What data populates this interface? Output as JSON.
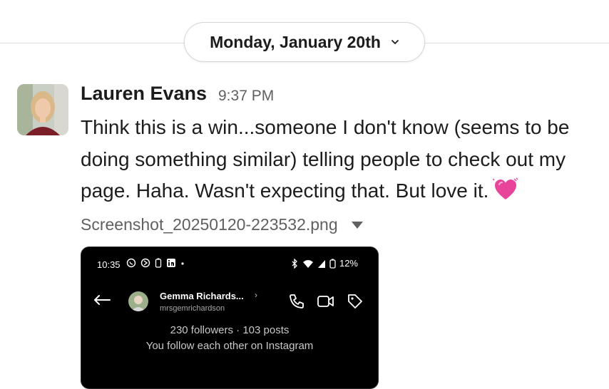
{
  "date_divider": {
    "label": "Monday, January 20th",
    "icon": "chevron-down-icon"
  },
  "message": {
    "author": "Lauren Evans",
    "time": "9:37 PM",
    "text": "Think this is a win...someone I don't know (seems to be doing something similar) telling people to check out my page. Haha. Wasn't expecting that. But love it.",
    "emoji": "heart-pulse-icon"
  },
  "attachment": {
    "file_name": "Screenshot_20250120-223532.png",
    "menu_icon": "caret-down-icon"
  },
  "screenshot": {
    "status_time": "10:35",
    "battery": "12%",
    "profile_name": "Gemma Richards...",
    "profile_handle": "mrsgemrichardson",
    "stats": "230 followers · 103 posts",
    "mutual": "You follow each other on Instagram"
  },
  "colors": {
    "text": "#1d1c1d",
    "muted": "#616061",
    "divider": "#dddddd",
    "heart": "#e8459a"
  }
}
